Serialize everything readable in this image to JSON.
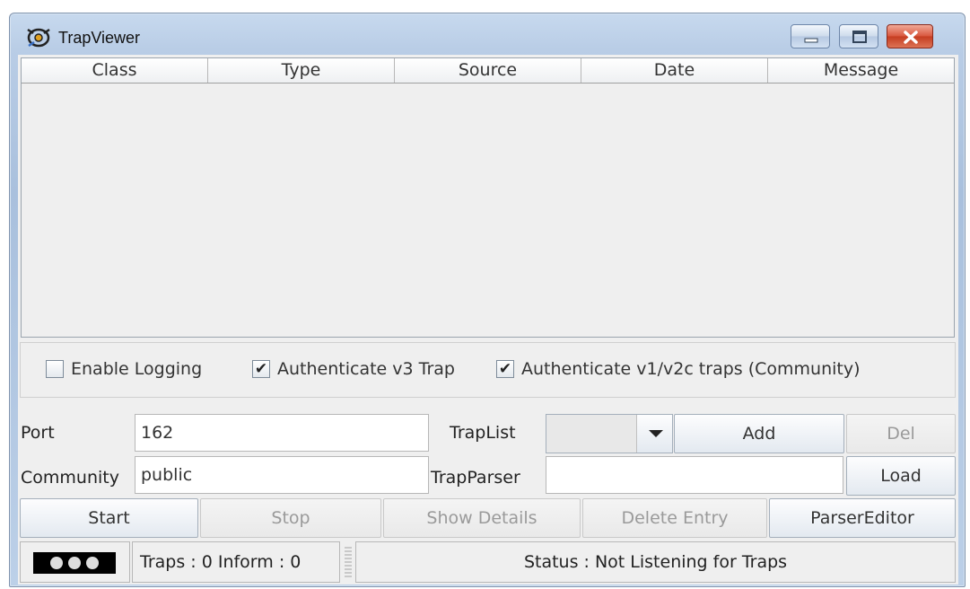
{
  "window": {
    "title": "TrapViewer"
  },
  "window_controls": {
    "minimize": "minimize-icon",
    "maximize": "maximize-icon",
    "close": "close-icon"
  },
  "table": {
    "columns": [
      "Class",
      "Type",
      "Source",
      "Date",
      "Message"
    ],
    "rows": []
  },
  "options": {
    "enable_logging": {
      "label": "Enable Logging",
      "checked": false
    },
    "auth_v3": {
      "label": "Authenticate v3 Trap",
      "checked": true
    },
    "auth_v1v2c": {
      "label": "Authenticate v1/v2c traps (Community)",
      "checked": true
    }
  },
  "form": {
    "port_label": "Port",
    "port_value": "162",
    "community_label": "Community",
    "community_value": "public",
    "traplist_label": "TrapList",
    "traplist_value": "",
    "trapparser_label": "TrapParser",
    "trapparser_value": "",
    "add_label": "Add",
    "del_label": "Del",
    "load_label": "Load"
  },
  "actions": {
    "start": "Start",
    "stop": "Stop",
    "show_details": "Show Details",
    "delete_entry": "Delete Entry",
    "parser_editor": "ParserEditor"
  },
  "status": {
    "counts": "Traps : 0 Inform : 0",
    "message": "Status : Not Listening for Traps"
  },
  "colors": {
    "title_bar": "#b9cde6",
    "close_button": "#c53c20",
    "panel_bg": "#efefef"
  }
}
